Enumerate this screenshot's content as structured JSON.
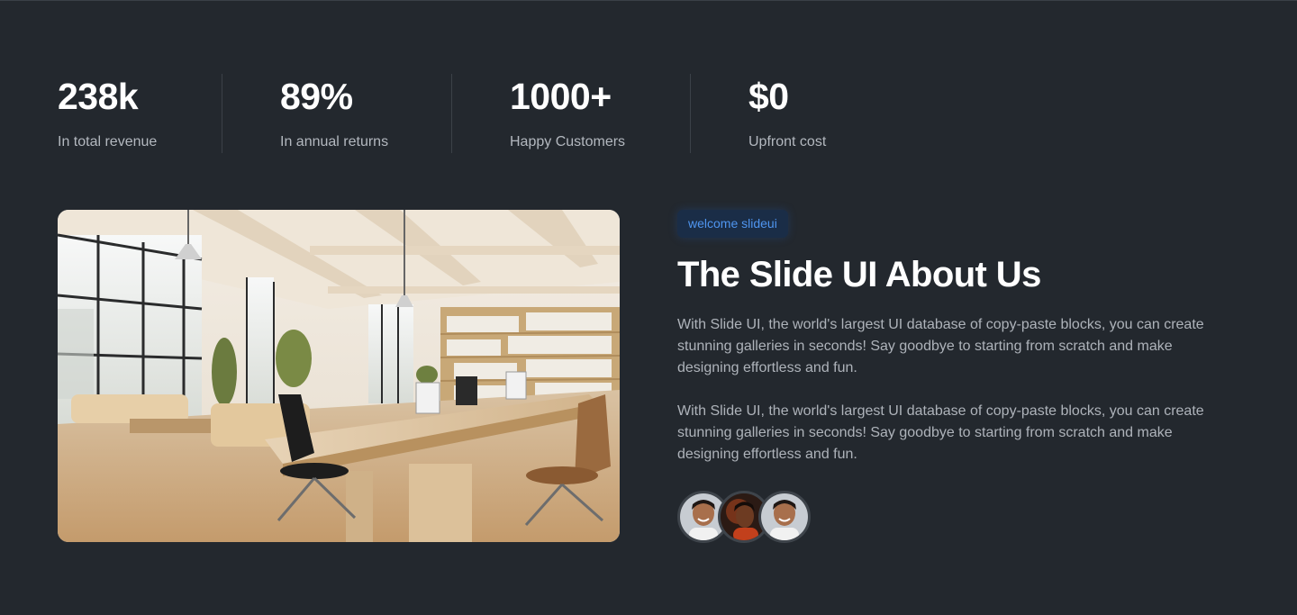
{
  "stats": [
    {
      "value": "238k",
      "label": "In total revenue"
    },
    {
      "value": "89%",
      "label": "In annual returns"
    },
    {
      "value": "1000+",
      "label": "Happy Customers"
    },
    {
      "value": "$0",
      "label": "Upfront cost"
    }
  ],
  "about": {
    "badge": "welcome slideui",
    "title": "The Slide UI About Us",
    "paragraphs": [
      "With Slide UI, the world's largest UI database of copy-paste blocks, you can create stunning galleries in seconds! Say goodbye to starting from scratch and make designing effortless and fun.",
      "With Slide UI, the world's largest UI database of copy-paste blocks, you can create stunning galleries in seconds! Say goodbye to starting from scratch and make designing effortless and fun."
    ]
  },
  "colors": {
    "background": "#23282e",
    "badge_text": "#4f95ef",
    "badge_bg": "#1a2d47",
    "muted_text": "#b3b8bf"
  }
}
